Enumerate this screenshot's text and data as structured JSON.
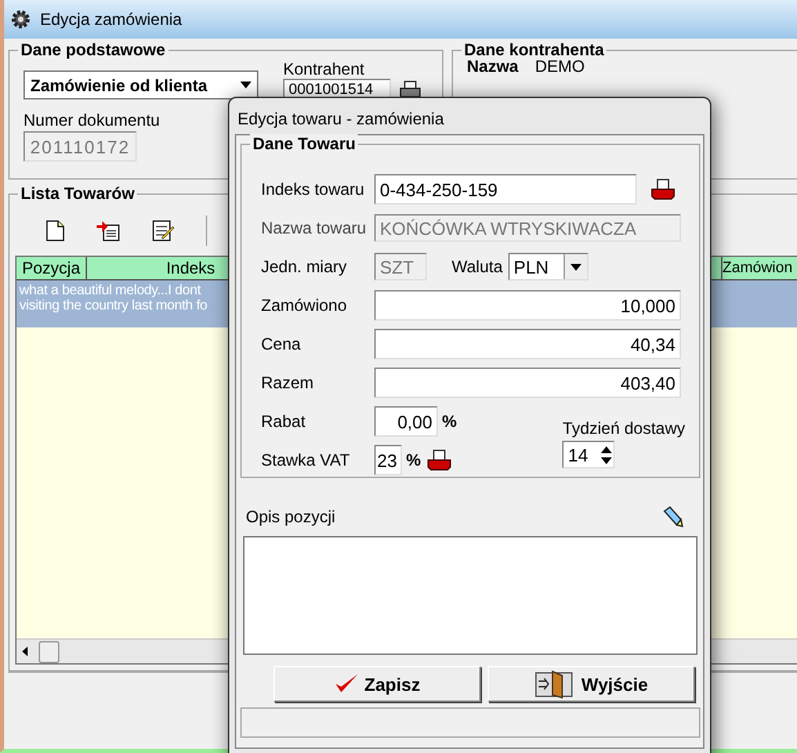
{
  "main_window": {
    "title": "Edycja zamówienia",
    "basic": {
      "title": "Dane podstawowe",
      "order_type": "Zamówienie od klienta",
      "contractor_label": "Kontrahent",
      "contractor": "0001001514",
      "doc_number_label": "Numer dokumentu",
      "doc_number": {
        "value": "201110172",
        "disabled": true
      }
    },
    "contractor_data": {
      "title": "Dane kontrahenta",
      "name_label": "Nazwa",
      "name": "DEMO"
    },
    "items": {
      "title": "Lista Towarów",
      "columns": [
        "Pozycja",
        "Indeks",
        "Zamówion"
      ],
      "rows": [
        {
          "lines": [
            "what a beautiful melody...I dont",
            "visiting the country last month fo"
          ],
          "selected": true
        }
      ]
    }
  },
  "dialog": {
    "title": "Edycja towaru - zamówienia",
    "group_title": "Dane Towaru",
    "index": {
      "label": "Indeks towaru",
      "value": "0-434-250-159"
    },
    "name": {
      "label": "Nazwa towaru",
      "value": "KOŃCÓWKA WTRYSKIWACZA",
      "disabled": true
    },
    "unit": {
      "label": "Jedn. miary",
      "value": "SZT",
      "disabled": true
    },
    "currency": {
      "label": "Waluta",
      "value": "PLN"
    },
    "amounts": [
      {
        "label": "Zamówiono",
        "value": "10,000"
      },
      {
        "label": "Cena",
        "value": "40,34"
      },
      {
        "label": "Razem",
        "value": "403,40"
      }
    ],
    "discount": {
      "label": "Rabat",
      "value": "0,00",
      "unit": "%"
    },
    "vat": {
      "label": "Stawka VAT",
      "value": "23",
      "unit": "%"
    },
    "week": {
      "label": "Tydzień dostawy",
      "value": "14"
    },
    "description": {
      "label": "Opis pozycji"
    },
    "buttons": [
      {
        "kind": "save",
        "label": "Zapisz"
      },
      {
        "kind": "exit",
        "label": "Wyjście"
      }
    ]
  }
}
